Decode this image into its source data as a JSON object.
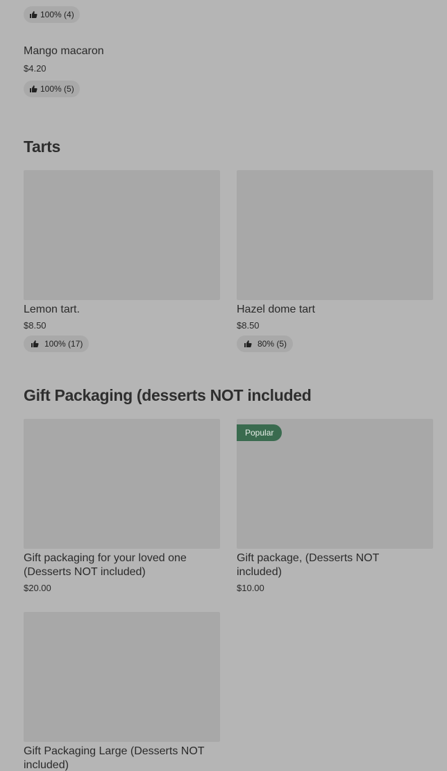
{
  "previous_item": {
    "rating": "100% (4)"
  },
  "macaron_item": {
    "name": "Mango macaron",
    "price": "$4.20",
    "rating": "100% (5)"
  },
  "tarts_section": {
    "title": "Tarts",
    "items": [
      {
        "name": "Lemon tart.",
        "price": "$8.50",
        "rating": "100% (17)"
      },
      {
        "name": "Hazel dome tart",
        "price": "$8.50",
        "rating": "80% (5)"
      }
    ]
  },
  "gift_section": {
    "title": "Gift Packaging (desserts NOT included",
    "items": [
      {
        "name_line1": "Gift packaging for your loved one",
        "name_line2": "(Desserts NOT included)",
        "price": "$20.00"
      },
      {
        "badge": "Popular",
        "name_line1": "Gift package,  (Desserts NOT",
        "name_line2": "included)",
        "price": "$10.00"
      },
      {
        "name_line1": "Gift Packaging Large (Desserts NOT",
        "name_line2": "included)"
      }
    ]
  },
  "icons": {
    "rating": "thumbs-up-icon"
  },
  "colors": {
    "background": "#b5b5b5",
    "image_placeholder": "#a8a8a8",
    "popular_badge": "#3a6b4f"
  }
}
